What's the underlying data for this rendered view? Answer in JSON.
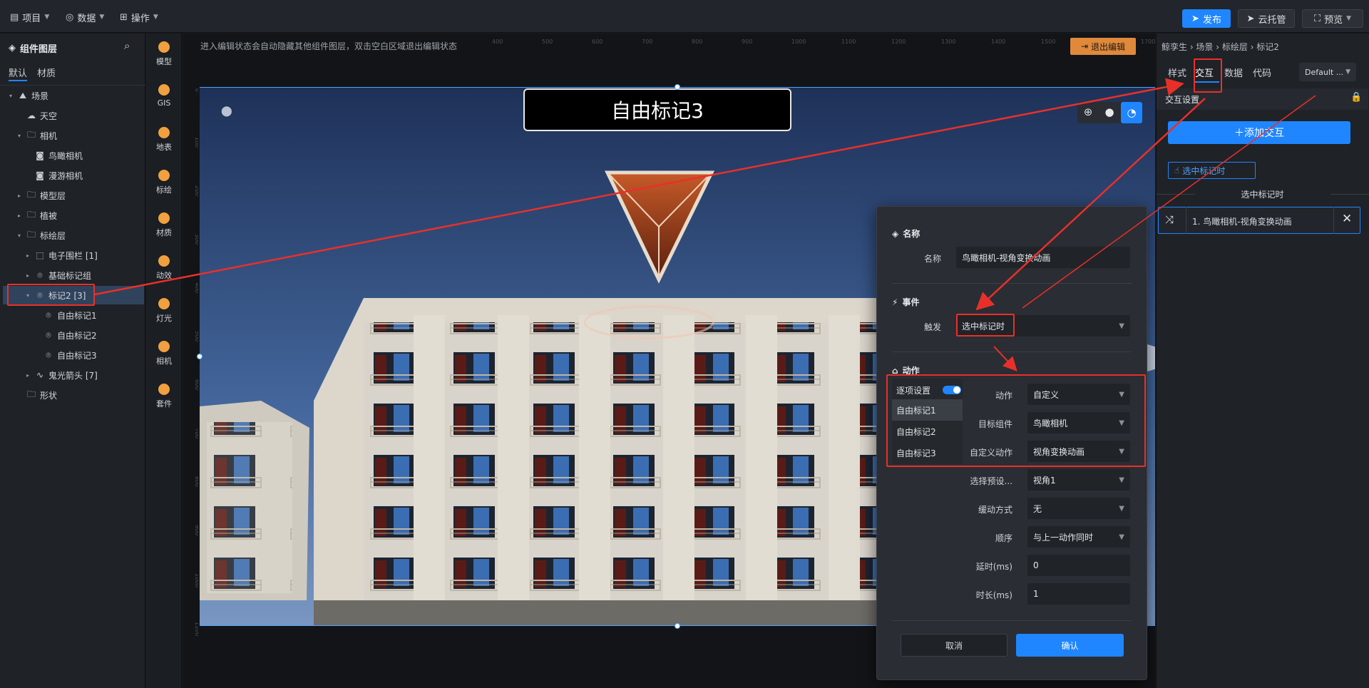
{
  "topbar": {
    "menus": [
      {
        "icon": "document-icon",
        "label": "项目"
      },
      {
        "icon": "database-icon",
        "label": "数据"
      },
      {
        "icon": "grid-icon",
        "label": "操作"
      }
    ],
    "publish": "发布",
    "cloud": "云托管",
    "preview": "预览"
  },
  "left": {
    "title": "组件图层",
    "tabs": [
      "默认",
      "材质"
    ],
    "tree": [
      {
        "label": "场景",
        "icon": "scene-icon",
        "arrow": "▾"
      },
      {
        "label": "天空",
        "icon": "cloud-icon",
        "arrow": ""
      },
      {
        "label": "相机",
        "icon": "folder-icon",
        "arrow": "▾"
      },
      {
        "label": "鸟瞰相机",
        "icon": "camera-icon",
        "arrow": ""
      },
      {
        "label": "漫游相机",
        "icon": "camera-icon",
        "arrow": ""
      },
      {
        "label": "模型层",
        "icon": "folder-icon",
        "arrow": "▸"
      },
      {
        "label": "植被",
        "icon": "folder-icon",
        "arrow": "▸"
      },
      {
        "label": "标绘层",
        "icon": "folder-icon",
        "arrow": "▾"
      },
      {
        "label": "电子围栏 [1]",
        "icon": "fence-icon",
        "arrow": "▸"
      },
      {
        "label": "基础标记组",
        "icon": "marker-icon",
        "arrow": "▸"
      },
      {
        "label": "标记2 [3]",
        "icon": "marker-icon",
        "arrow": "▾"
      },
      {
        "label": "自由标记1",
        "icon": "marker-icon",
        "arrow": ""
      },
      {
        "label": "自由标记2",
        "icon": "marker-icon",
        "arrow": ""
      },
      {
        "label": "自由标记3",
        "icon": "marker-icon",
        "arrow": ""
      },
      {
        "label": "鬼光箭头 [7]",
        "icon": "arrow-path-icon",
        "arrow": "▸"
      },
      {
        "label": "形状",
        "icon": "folder-icon",
        "arrow": ""
      }
    ]
  },
  "tools": [
    "模型",
    "GIS",
    "地表",
    "标绘",
    "材质",
    "动效",
    "灯光",
    "相机",
    "套件"
  ],
  "canvas": {
    "hint": "进入编辑状态会自动隐藏其他组件图层，双击空白区域退出编辑状态",
    "exit_edit": "退出编辑",
    "marker_title": "自由标记3",
    "ruler_h": [
      "400",
      "500",
      "600",
      "700",
      "800",
      "900",
      "1000",
      "1100",
      "1200",
      "1300",
      "1400",
      "1500",
      "1600",
      "1700",
      "1800"
    ],
    "ruler_v": [
      "0",
      "100",
      "200",
      "300",
      "400",
      "500",
      "600",
      "700",
      "800",
      "900",
      "1000",
      "1100"
    ]
  },
  "modal": {
    "name_section": "名称",
    "name_label": "名称",
    "name_value": "鸟瞰相机-视角变换动画",
    "event_section": "事件",
    "trigger_label": "触发",
    "trigger_value": "选中标记时",
    "action_section": "动作",
    "per_item": "逐项设置",
    "items": [
      "自由标记1",
      "自由标记2",
      "自由标记3"
    ],
    "fields": [
      {
        "label": "动作",
        "value": "自定义"
      },
      {
        "label": "目标组件",
        "value": "鸟瞰相机"
      },
      {
        "label": "自定义动作",
        "value": "视角变换动画"
      },
      {
        "label": "选择预设...",
        "value": "视角1"
      },
      {
        "label": "缓动方式",
        "value": "无"
      },
      {
        "label": "顺序",
        "value": "与上一动作同时"
      },
      {
        "label": "延时(ms)",
        "value": "0"
      },
      {
        "label": "时长(ms)",
        "value": "1"
      }
    ],
    "cancel": "取消",
    "confirm": "确认"
  },
  "right": {
    "breadcrumb": "鲸孪生 › 场景 › 标绘层 › 标记2",
    "tabs": [
      "样式",
      "交互",
      "数据",
      "代码"
    ],
    "theme_select": "Default ...",
    "section": "交互设置",
    "add_button": "＋添加交互",
    "filter_tag": "选中标记时",
    "group_title": "选中标记时",
    "interaction_item": "1. 鸟瞰相机-视角变换动画"
  },
  "colors": {
    "accent": "#1f86ff",
    "highlight": "#e8302a",
    "exit_edit": "#e0893a"
  }
}
